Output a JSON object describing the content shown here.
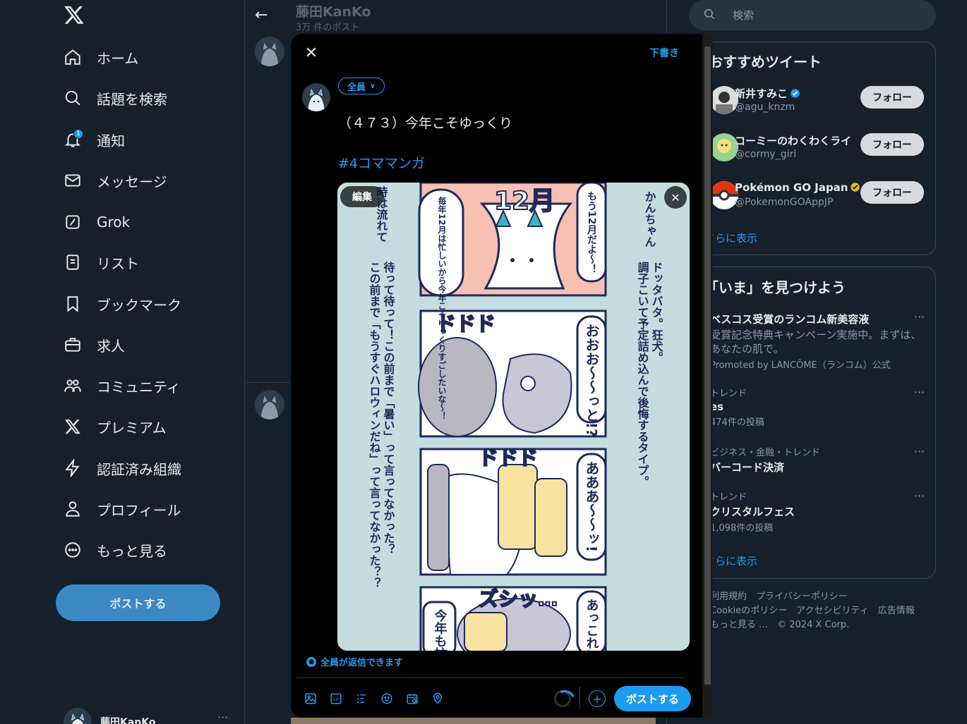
{
  "left_nav": {
    "items": [
      {
        "label": "ホーム",
        "icon": "home-icon"
      },
      {
        "label": "話題を検索",
        "icon": "search-icon"
      },
      {
        "label": "通知",
        "icon": "bell-icon",
        "badge": "1"
      },
      {
        "label": "メッセージ",
        "icon": "mail-icon"
      },
      {
        "label": "Grok",
        "icon": "grok-icon"
      },
      {
        "label": "リスト",
        "icon": "list-icon"
      },
      {
        "label": "ブックマーク",
        "icon": "bookmark-icon"
      },
      {
        "label": "求人",
        "icon": "briefcase-icon"
      },
      {
        "label": "コミュニティ",
        "icon": "community-icon"
      },
      {
        "label": "プレミアム",
        "icon": "x-premium-icon"
      },
      {
        "label": "認証済み組織",
        "icon": "lightning-icon"
      },
      {
        "label": "プロフィール",
        "icon": "person-icon"
      },
      {
        "label": "もっと見る",
        "icon": "more-circle-icon"
      }
    ],
    "post_button": "ポストする",
    "account_name": "藤田KanKo",
    "account_more": "···"
  },
  "middle": {
    "profile_name": "藤田KanKo",
    "post_count": "3万 件のポスト"
  },
  "right": {
    "search_placeholder": "検索",
    "recommend_title": "おすすめツイート",
    "recommendations": [
      {
        "name": "新井すみこ",
        "handle": "@agu_knzm",
        "follow": "フォロー",
        "verified": "blue"
      },
      {
        "name": "コーミーのわくわくライ",
        "handle": "@cormy_girl",
        "follow": "フォロー",
        "verified": "none"
      },
      {
        "name": "Pokémon GO Japan",
        "handle": "@PokemonGOAppJP",
        "follow": "フォロー",
        "verified": "gold"
      }
    ],
    "recommend_more": "さらに表示",
    "trends_title": "「いま」を見つけよう",
    "trends": [
      {
        "category": "",
        "title": "ベスコス受賞のランコム新美容液",
        "sub": "",
        "desc": "受賞記念特典キャンペーン実施中。まずは、あなたの肌で。",
        "promoted": "Promoted by LANCÔME（ランコム）公式"
      },
      {
        "category": "トレンド",
        "title": "es",
        "sub": "474件の投稿"
      },
      {
        "category": "ビジネス・金融・トレンド",
        "title": "バーコード決済",
        "sub": ""
      },
      {
        "category": "トレンド",
        "title": "クリスタルフェス",
        "sub": "1,098件の投稿"
      }
    ],
    "trends_more": "さらに表示",
    "footer": {
      "line1": "利用規約　プライバシーポリシー",
      "line2": "Cookieのポリシー　アクセシビリティ　広告情報",
      "line3": "もっと見る …　© 2024 X Corp."
    }
  },
  "composer": {
    "drafts": "下書き",
    "audience": "全員",
    "text": "（４７３）今年こそゆっくり",
    "hashtag": "#4コママンガ",
    "edit": "編集",
    "reply_setting": "全員が返信できます",
    "submit": "ポストする",
    "comic_text": {
      "side1": "かんちゃん",
      "side2": "ドッタバタ。狂犬。",
      "side3": "調子こいて予定詰め込んで後悔するタイプ。",
      "panel1_title": "12月",
      "panel1_bubble1": "もう12月だよ〜！",
      "panel1_bubble2": "毎年12月は忙しいから今年こそゆっくりすごしたいな〜！",
      "panel2_sfx": "ドドド",
      "panel2_speech": "おおお〜〜っと!?",
      "panel3_sfx": "ドドド",
      "panel3_speech": "あああ〜〜ッ!",
      "panel4_sfx": "ズシッ…",
      "panel4_speech1": "あっこれ…",
      "panel4_speech2": "今年も忙しいパ",
      "narration1": "時は流れて",
      "narration2": "待って待って！この前まで「暑い」って言ってなかった？",
      "narration3": "この前まで「もうすぐハロウィンだね」って言ってなかった？？"
    }
  },
  "colors": {
    "accent": "#1d9bf0",
    "bg": "#15202b",
    "modal_bg": "#000000",
    "left_post_button": "#3b88c3"
  }
}
